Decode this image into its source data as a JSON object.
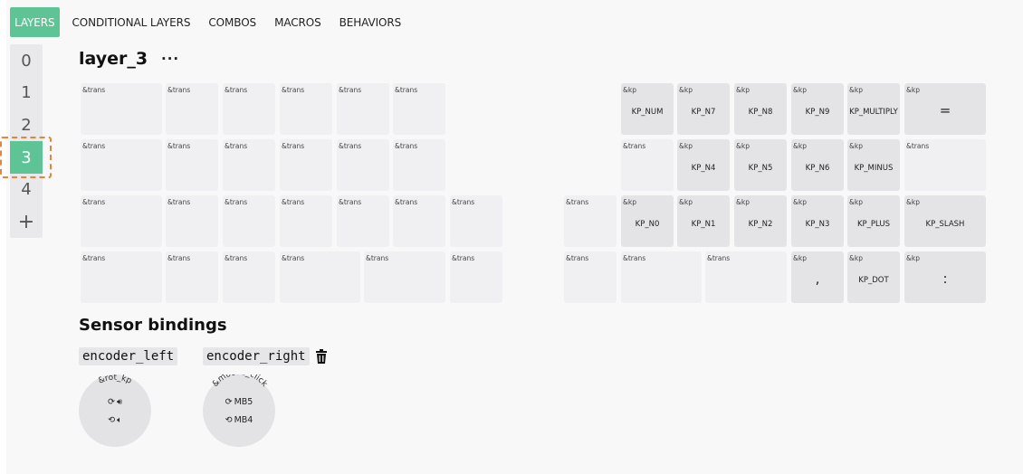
{
  "tabs": [
    {
      "label": "LAYERS",
      "active": true
    },
    {
      "label": "CONDITIONAL LAYERS",
      "active": false
    },
    {
      "label": "COMBOS",
      "active": false
    },
    {
      "label": "MACROS",
      "active": false
    },
    {
      "label": "BEHAVIORS",
      "active": false
    }
  ],
  "layers": {
    "items": [
      "0",
      "1",
      "2",
      "3",
      "4"
    ],
    "selected": "3",
    "add_label": "+"
  },
  "layer": {
    "title": "layer_3",
    "menu_label": "···"
  },
  "keys": [
    {
      "behavior": "&trans",
      "param": ""
    },
    {
      "behavior": "&trans",
      "param": ""
    },
    {
      "behavior": "&trans",
      "param": ""
    },
    {
      "behavior": "&trans",
      "param": ""
    },
    {
      "behavior": "&trans",
      "param": ""
    },
    {
      "behavior": "&trans",
      "param": ""
    },
    {
      "behavior": "&kp",
      "param": "KP_NUM"
    },
    {
      "behavior": "&kp",
      "param": "KP_N7"
    },
    {
      "behavior": "&kp",
      "param": "KP_N8"
    },
    {
      "behavior": "&kp",
      "param": "KP_N9"
    },
    {
      "behavior": "&kp",
      "param": "KP_MULTIPLY"
    },
    {
      "behavior": "&kp",
      "param": "="
    },
    {
      "behavior": "&trans",
      "param": ""
    },
    {
      "behavior": "&trans",
      "param": ""
    },
    {
      "behavior": "&trans",
      "param": ""
    },
    {
      "behavior": "&trans",
      "param": ""
    },
    {
      "behavior": "&trans",
      "param": ""
    },
    {
      "behavior": "&trans",
      "param": ""
    },
    {
      "behavior": "&trans",
      "param": ""
    },
    {
      "behavior": "&kp",
      "param": "KP_N4"
    },
    {
      "behavior": "&kp",
      "param": "KP_N5"
    },
    {
      "behavior": "&kp",
      "param": "KP_N6"
    },
    {
      "behavior": "&kp",
      "param": "KP_MINUS"
    },
    {
      "behavior": "&trans",
      "param": ""
    },
    {
      "behavior": "&trans",
      "param": ""
    },
    {
      "behavior": "&trans",
      "param": ""
    },
    {
      "behavior": "&trans",
      "param": ""
    },
    {
      "behavior": "&trans",
      "param": ""
    },
    {
      "behavior": "&trans",
      "param": ""
    },
    {
      "behavior": "&trans",
      "param": ""
    },
    {
      "behavior": "&trans",
      "param": ""
    },
    {
      "behavior": "&trans",
      "param": ""
    },
    {
      "behavior": "&kp",
      "param": "KP_N0"
    },
    {
      "behavior": "&kp",
      "param": "KP_N1"
    },
    {
      "behavior": "&kp",
      "param": "KP_N2"
    },
    {
      "behavior": "&kp",
      "param": "KP_N3"
    },
    {
      "behavior": "&kp",
      "param": "KP_PLUS"
    },
    {
      "behavior": "&kp",
      "param": "KP_SLASH"
    },
    {
      "behavior": "&trans",
      "param": ""
    },
    {
      "behavior": "&trans",
      "param": ""
    },
    {
      "behavior": "&trans",
      "param": ""
    },
    {
      "behavior": "&trans",
      "param": ""
    },
    {
      "behavior": "&trans",
      "param": ""
    },
    {
      "behavior": "&trans",
      "param": ""
    },
    {
      "behavior": "&trans",
      "param": ""
    },
    {
      "behavior": "&trans",
      "param": ""
    },
    {
      "behavior": "&trans",
      "param": ""
    },
    {
      "behavior": "&kp",
      "param": ","
    },
    {
      "behavior": "&kp",
      "param": "KP_DOT"
    },
    {
      "behavior": "&kp",
      "param": ":"
    }
  ],
  "sensors": {
    "title": "Sensor bindings",
    "encoders": [
      {
        "label": "encoder_left",
        "behavior": "&rot_kp",
        "cw_icon": "volume-up-icon",
        "ccw_icon": "volume-down-icon",
        "cw": "",
        "ccw": ""
      },
      {
        "label": "encoder_right",
        "behavior": "&mouse_click",
        "cw": "MB5",
        "ccw": "MB4"
      }
    ],
    "delete_icon": "trash-icon"
  },
  "colors": {
    "accent": "#5ec495",
    "selection_outline": "#e8823c",
    "key_trans": "#f0f0f2",
    "key_bound": "#e4e4e7"
  }
}
